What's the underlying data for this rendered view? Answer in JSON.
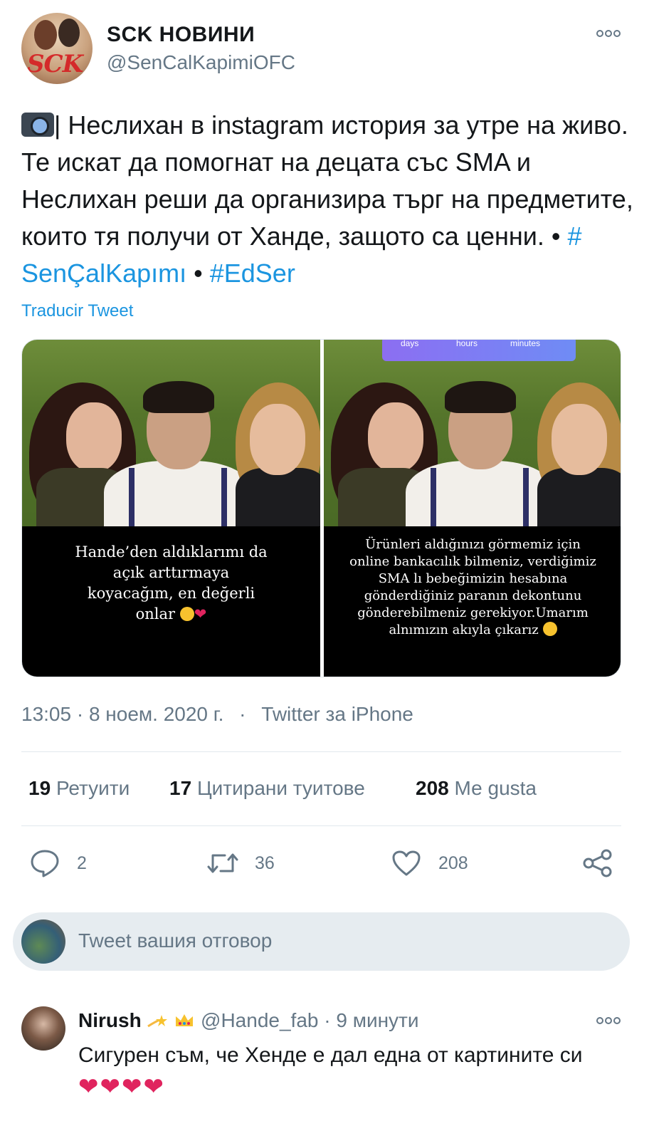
{
  "tweet": {
    "display_name": "SCK НОВИНИ",
    "handle": "@SenCalKapimiOFC",
    "more_icon": "more-dots-icon",
    "text_part1": "| Неслихан в instagram история за утре на живо. Те искат да помогнат на децата със SMA и Неслихан реши да организира търг на предметите, които тя получи от Ханде, защото са ценни. • ",
    "hashtag1": "# SenÇalKapımı",
    "sep": " • ",
    "hashtag2": "#EdSer",
    "translate": "Traducir Tweet",
    "avatar_logo": "SCK",
    "media": {
      "left_caption": "Hande’den aldıklarımı da açık arttırmaya koyacağım, en değerli onlar",
      "right_caption": "Ürünleri aldığınızı görmemiz için online bankacılık bilmeniz, verdiğimiz SMA lı bebeğimizin hesabına gönderdiğiniz paranın dekontunu gönderebilmeniz gerekiyor.Umarım alnımızın akıyla çıkarız",
      "countdown_labels": [
        "days",
        "hours",
        "minutes"
      ]
    },
    "meta": {
      "time": "13:05 · 8 ноем. 2020 г.",
      "dot": " · ",
      "source": "Twitter за iPhone"
    },
    "stats": {
      "retweets_count": "19",
      "retweets_label": "Ретуити",
      "quotes_count": "17",
      "quotes_label": "Цитирани туитове",
      "likes_count": "208",
      "likes_label": "Ме gusta"
    },
    "actions": {
      "reply_count": "2",
      "retweet_count": "36",
      "like_count": "208"
    }
  },
  "reply_box": {
    "placeholder": "Tweet вашия отговор"
  },
  "reply": {
    "name": "Nirush",
    "handle": "@Hande_fab",
    "time": "· 9 минути",
    "text": "Сигурен съм, че Хенде е дал една от картините си",
    "hearts": "❤❤❤❤"
  },
  "colors": {
    "link": "#1b95e0",
    "secondary_text": "#657786",
    "primary_text": "#14171a",
    "divider": "#e1e8ed",
    "reply_box_bg": "#e6ecf0",
    "heart": "#e0245e"
  }
}
